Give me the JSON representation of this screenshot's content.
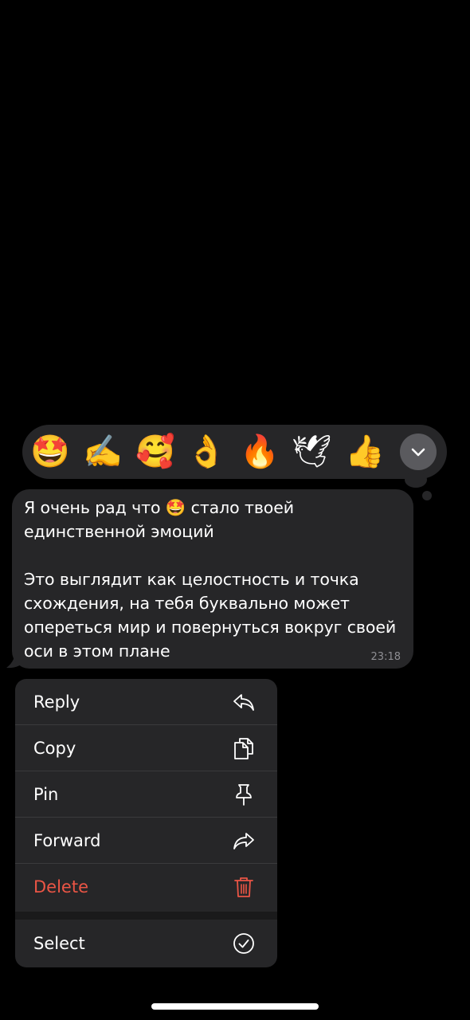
{
  "reactions": [
    {
      "emoji": "🤩",
      "name": "star-struck"
    },
    {
      "emoji": "✍️",
      "name": "writing-hand"
    },
    {
      "emoji": "🥰",
      "name": "smiling-face-with-hearts"
    },
    {
      "emoji": "👌",
      "name": "ok-hand"
    },
    {
      "emoji": "🔥",
      "name": "fire"
    },
    {
      "emoji": "🕊",
      "name": "dove"
    },
    {
      "emoji": "👍",
      "name": "thumbs-up"
    }
  ],
  "message": {
    "text": "Я очень рад что 🤩 стало твоей\nединственной эмоций\n\nЭто выглядит как целостность и точка\nсхождения, на тебя буквально может\nопереться мир и повернуться вокруг своей\nоси в этом плане",
    "time": "23:18"
  },
  "menu": {
    "reply": "Reply",
    "copy": "Copy",
    "pin": "Pin",
    "forward": "Forward",
    "delete": "Delete",
    "select": "Select"
  },
  "colors": {
    "background": "#000000",
    "surface": "#262628",
    "destructive": "#eb5545",
    "secondary_text": "#8e8e93"
  }
}
